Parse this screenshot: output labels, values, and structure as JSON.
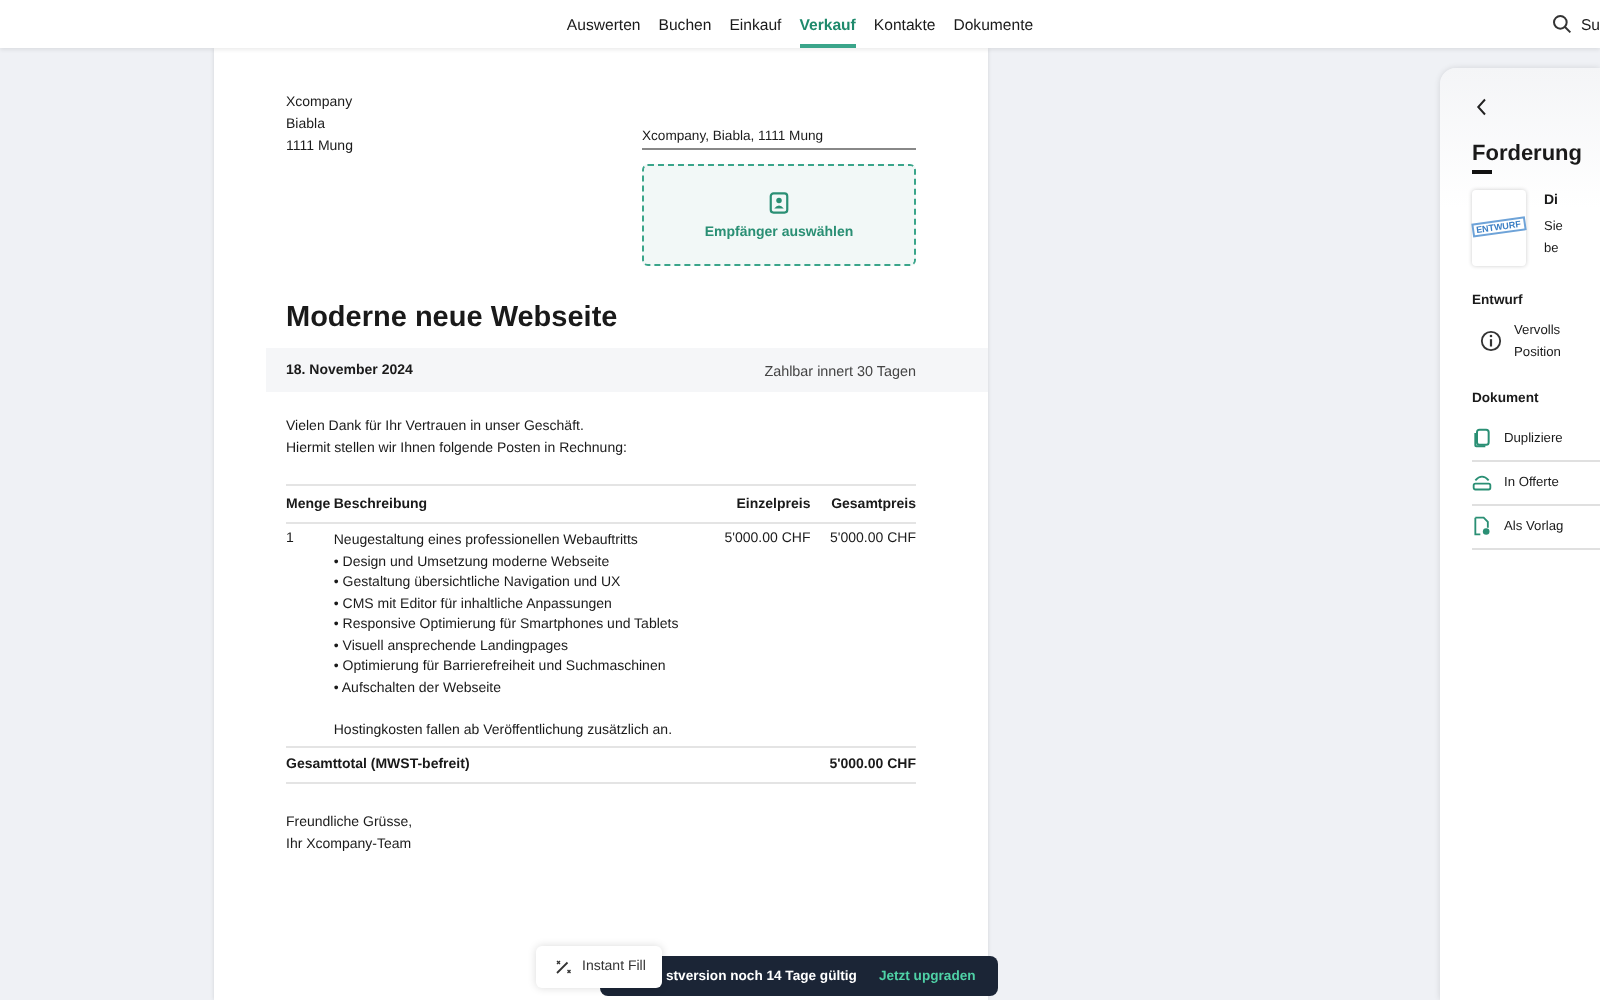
{
  "nav": {
    "tabs": [
      {
        "label": "Auswerten",
        "selected": false
      },
      {
        "label": "Buchen",
        "selected": false
      },
      {
        "label": "Einkauf",
        "selected": false
      },
      {
        "label": "Verkauf",
        "selected": true
      },
      {
        "label": "Kontakte",
        "selected": false
      },
      {
        "label": "Dokumente",
        "selected": false
      }
    ],
    "search": {
      "label": "Su"
    }
  },
  "document": {
    "sender": [
      "Xcompany",
      "Biabla",
      "1111 Mung"
    ],
    "return_address": "Xcompany, Biabla, 1111 Mung",
    "recipient_button": "Empfänger auswählen",
    "title": "Moderne neue Webseite",
    "date": "18. November 2024",
    "due": "Zahlbar innert 30 Tagen",
    "intro": [
      "Vielen Dank für Ihr Vertrauen in unser Geschäft.",
      "Hiermit stellen wir Ihnen folgende Posten in Rechnung:"
    ],
    "table": {
      "columns": [
        "Menge",
        "Beschreibung",
        "Einzelpreis",
        "Gesamtpreis"
      ],
      "rows": [
        {
          "quantity": "1",
          "description": "Neugestaltung eines professionellen Webauftritts",
          "bullets": [
            "• Design und Umsetzung moderne Webseite",
            "• Gestaltung übersichtliche Navigation und UX",
            "• CMS mit Editor für inhaltliche Anpassungen",
            "• Responsive Optimierung für Smartphones und Tablets",
            "• Visuell ansprechende Landingpages",
            "• Optimierung für Barrierefreiheit und Suchmaschinen",
            "• Aufschalten der Webseite"
          ],
          "note": "Hostingkosten fallen ab Veröffentlichung zusätzlich an.",
          "unit_price": "5'000.00 CHF",
          "total": "5'000.00 CHF"
        }
      ],
      "total_label": "Gesamttotal (MWST-befreit)",
      "total_value": "5'000.00 CHF"
    },
    "closing": [
      "Freundliche Grüsse,",
      "Ihr Xcompany-Team"
    ]
  },
  "side_panel": {
    "title": "Forderung",
    "card": {
      "stamp": "ENTWURF",
      "title": "Di",
      "lines": [
        "Sie",
        "be"
      ]
    },
    "sections": [
      {
        "heading": "Entwurf",
        "items": [
          {
            "kind": "info",
            "lines": [
              "Vervolls",
              "Position"
            ]
          }
        ]
      },
      {
        "heading": "Dokument",
        "items": [
          {
            "kind": "duplicate",
            "lines": [
              "Dupliziere"
            ]
          },
          {
            "kind": "offer",
            "lines": [
              "In Offerte"
            ]
          },
          {
            "kind": "template",
            "lines": [
              "Als Vorlag"
            ]
          }
        ]
      }
    ]
  },
  "instant_fill": {
    "label": "Instant Fill"
  },
  "trial_banner": {
    "text": "stversion noch 14 Tage gültig",
    "action": "Jetzt upgraden"
  }
}
